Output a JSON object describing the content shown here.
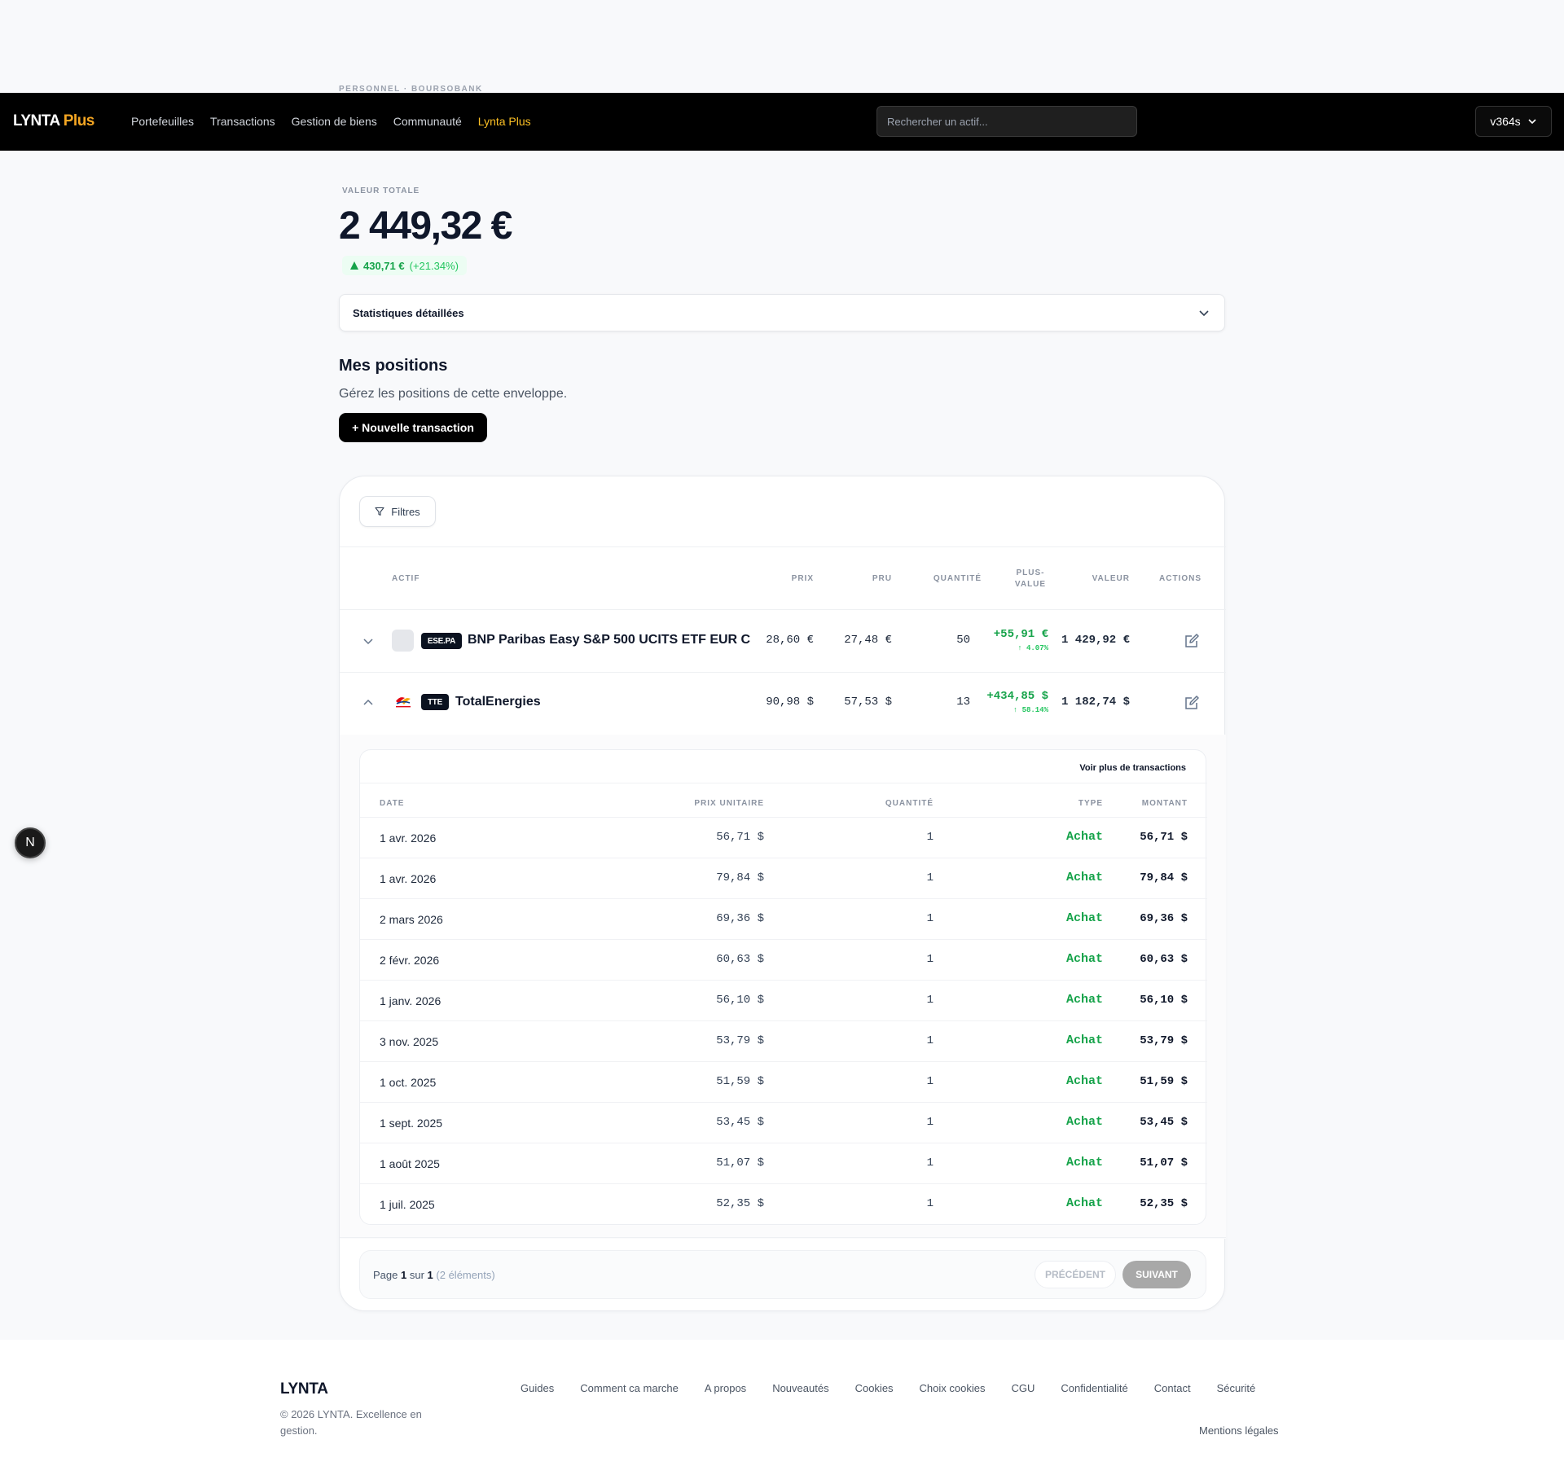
{
  "breadcrumb": "PERSONNEL · BOURSOBANK",
  "header": {
    "brand_main": "LYNTA",
    "brand_plus": "Plus",
    "nav": [
      "Portefeuilles",
      "Transactions",
      "Gestion de biens",
      "Communauté",
      "Lynta Plus"
    ],
    "search_placeholder": "Rechercher un actif...",
    "user": "v364s"
  },
  "summary": {
    "label": "VALEUR TOTALE",
    "value": "2 449,32 €",
    "change_abs": "430,71 €",
    "change_pct": "(+21.34%)"
  },
  "stats_toggle": "Statistiques détaillées",
  "positions": {
    "title": "Mes positions",
    "subtitle": "Gérez les positions de cette enveloppe.",
    "new_button": "+ Nouvelle transaction",
    "filter_button": "Filtres",
    "columns": {
      "actif": "ACTIF",
      "prix": "PRIX",
      "pru": "PRU",
      "quantite": "QUANTITÉ",
      "plus_value_1": "PLUS-",
      "plus_value_2": "VALUE",
      "valeur": "VALEUR",
      "actions": "ACTIONS"
    },
    "rows": [
      {
        "ticker": "ESE.PA",
        "name": "BNP Paribas Easy S&P 500 UCITS ETF EUR C",
        "prix": "28,60 €",
        "pru": "27,48 €",
        "quantite": "50",
        "pv": "+55,91 €",
        "pv_pct": "↑ 4.07%",
        "valeur": "1 429,92 €"
      },
      {
        "ticker": "TTE",
        "name": "TotalEnergies",
        "prix": "90,98 $",
        "pru": "57,53 $",
        "quantite": "13",
        "pv": "+434,85 $",
        "pv_pct": "↑ 58.14%",
        "valeur": "1 182,74 $"
      }
    ],
    "detail": {
      "more_link": "Voir plus de transactions",
      "columns": {
        "date": "DATE",
        "unit_price": "PRIX UNITAIRE",
        "quantity": "QUANTITÉ",
        "type": "TYPE",
        "amount": "MONTANT"
      },
      "transactions": [
        {
          "date": "1 avr. 2026",
          "price": "56,71 $",
          "qty": "1",
          "type": "Achat",
          "amount": "56,71 $"
        },
        {
          "date": "1 avr. 2026",
          "price": "79,84 $",
          "qty": "1",
          "type": "Achat",
          "amount": "79,84 $"
        },
        {
          "date": "2 mars 2026",
          "price": "69,36 $",
          "qty": "1",
          "type": "Achat",
          "amount": "69,36 $"
        },
        {
          "date": "2 févr. 2026",
          "price": "60,63 $",
          "qty": "1",
          "type": "Achat",
          "amount": "60,63 $"
        },
        {
          "date": "1 janv. 2026",
          "price": "56,10 $",
          "qty": "1",
          "type": "Achat",
          "amount": "56,10 $"
        },
        {
          "date": "3 nov. 2025",
          "price": "53,79 $",
          "qty": "1",
          "type": "Achat",
          "amount": "53,79 $"
        },
        {
          "date": "1 oct. 2025",
          "price": "51,59 $",
          "qty": "1",
          "type": "Achat",
          "amount": "51,59 $"
        },
        {
          "date": "1 sept. 2025",
          "price": "53,45 $",
          "qty": "1",
          "type": "Achat",
          "amount": "53,45 $"
        },
        {
          "date": "1 août 2025",
          "price": "51,07 $",
          "qty": "1",
          "type": "Achat",
          "amount": "51,07 $"
        },
        {
          "date": "1 juil. 2025",
          "price": "52,35 $",
          "qty": "1",
          "type": "Achat",
          "amount": "52,35 $"
        }
      ]
    },
    "pager": {
      "page_word": "Page",
      "page": "1",
      "of_word": "sur",
      "total_pages": "1",
      "count": "(2 éléments)",
      "prev": "PRÉCÉDENT",
      "next": "SUIVANT"
    }
  },
  "fab_letter": "N",
  "footer": {
    "brand": "LYNTA",
    "copyright": "© 2026 LYNTA. Excellence en gestion.",
    "links": [
      "Guides",
      "Comment ca marche",
      "A propos",
      "Nouveautés",
      "Cookies",
      "Choix cookies",
      "CGU",
      "Confidentialité",
      "Contact",
      "Sécurité"
    ],
    "legal": "Mentions légales"
  },
  "colors": {
    "accent": "#fbbf24",
    "positive": "#16a34a",
    "topbar": "#000000"
  }
}
